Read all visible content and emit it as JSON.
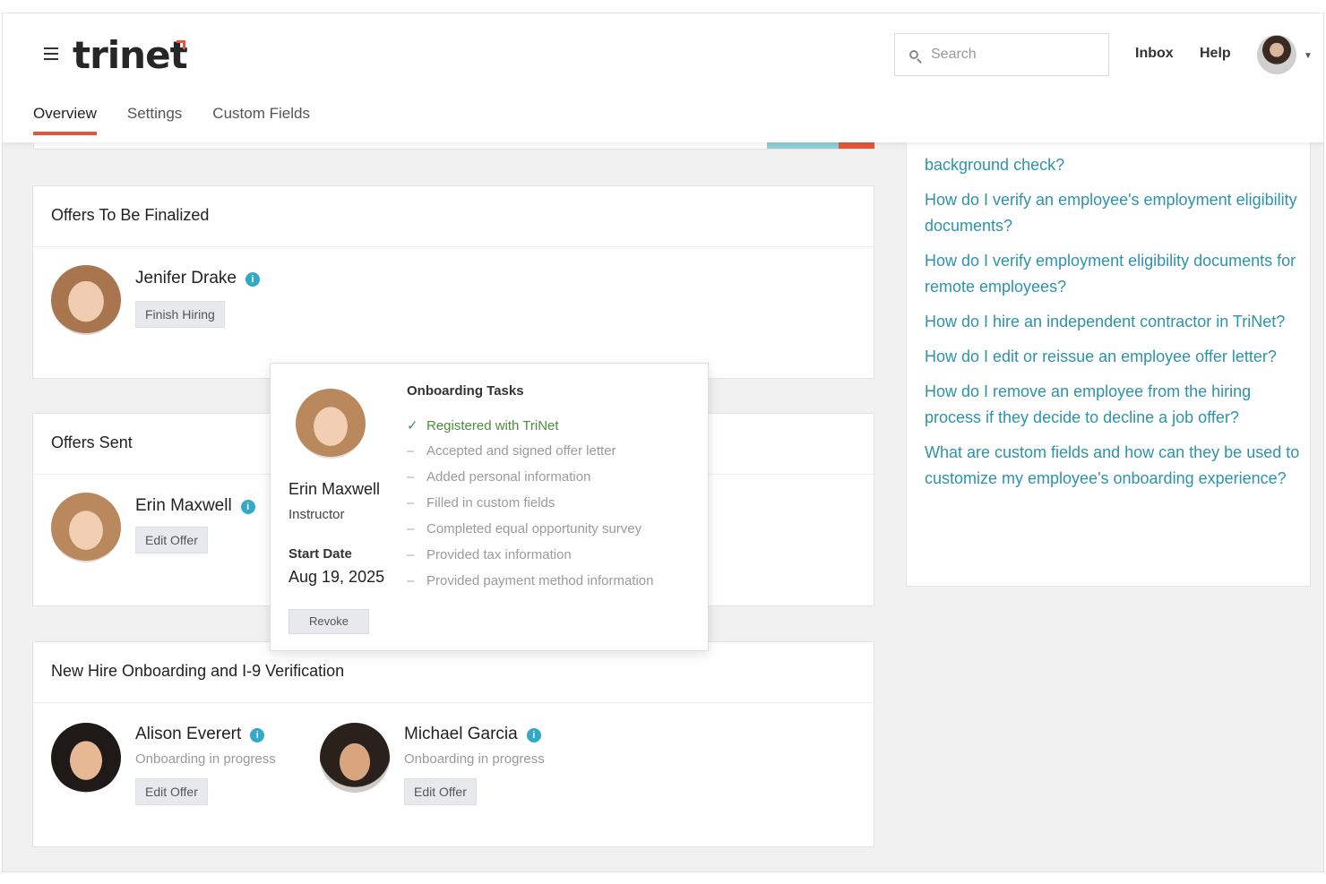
{
  "header": {
    "logo": "trinet",
    "search_placeholder": "Search",
    "inbox": "Inbox",
    "help": "Help",
    "tabs": [
      {
        "label": "Overview",
        "active": true
      },
      {
        "label": "Settings",
        "active": false
      },
      {
        "label": "Custom Fields",
        "active": false
      }
    ]
  },
  "offers_to_finalize": {
    "title": "Offers To Be Finalized",
    "people": [
      {
        "name": "Jenifer Drake",
        "button": "Finish Hiring"
      }
    ]
  },
  "offers_sent": {
    "title": "Offers Sent",
    "people": [
      {
        "name": "Erin Maxwell",
        "button": "Edit Offer"
      }
    ]
  },
  "onboarding": {
    "title": "New Hire Onboarding and I-9 Verification",
    "people": [
      {
        "name": "Alison Everert",
        "status": "Onboarding in progress",
        "button": "Edit Offer"
      },
      {
        "name": "Michael Garcia",
        "status": "Onboarding in progress",
        "button": "Edit Offer"
      }
    ]
  },
  "popup": {
    "name": "Erin Maxwell",
    "role": "Instructor",
    "start_date_label": "Start Date",
    "start_date": "Aug 19, 2025",
    "revoke": "Revoke",
    "tasks_title": "Onboarding Tasks",
    "tasks": [
      {
        "label": "Registered with TriNet",
        "done": true
      },
      {
        "label": "Accepted and signed offer letter",
        "done": false
      },
      {
        "label": "Added personal information",
        "done": false
      },
      {
        "label": "Filled in custom fields",
        "done": false
      },
      {
        "label": "Completed equal opportunity survey",
        "done": false
      },
      {
        "label": "Provided tax information",
        "done": false
      },
      {
        "label": "Provided payment method information",
        "done": false
      }
    ]
  },
  "help_panel": {
    "links": [
      "background check?",
      "How do I verify an employee's employment eligibility documents?",
      "How do I verify employment eligibility documents for remote employees?",
      "How do I hire an independent contractor in TriNet?",
      "How do I edit or reissue an employee offer letter?",
      "How do I remove an employee from the hiring process if they decide to decline a job offer?",
      "What are custom fields and how can they be used to customize my employee's onboarding experience?"
    ]
  },
  "colors": {
    "accent": "#e4573d",
    "link": "#2d93aa",
    "info": "#33a8c7",
    "done": "#4a8f3a"
  }
}
